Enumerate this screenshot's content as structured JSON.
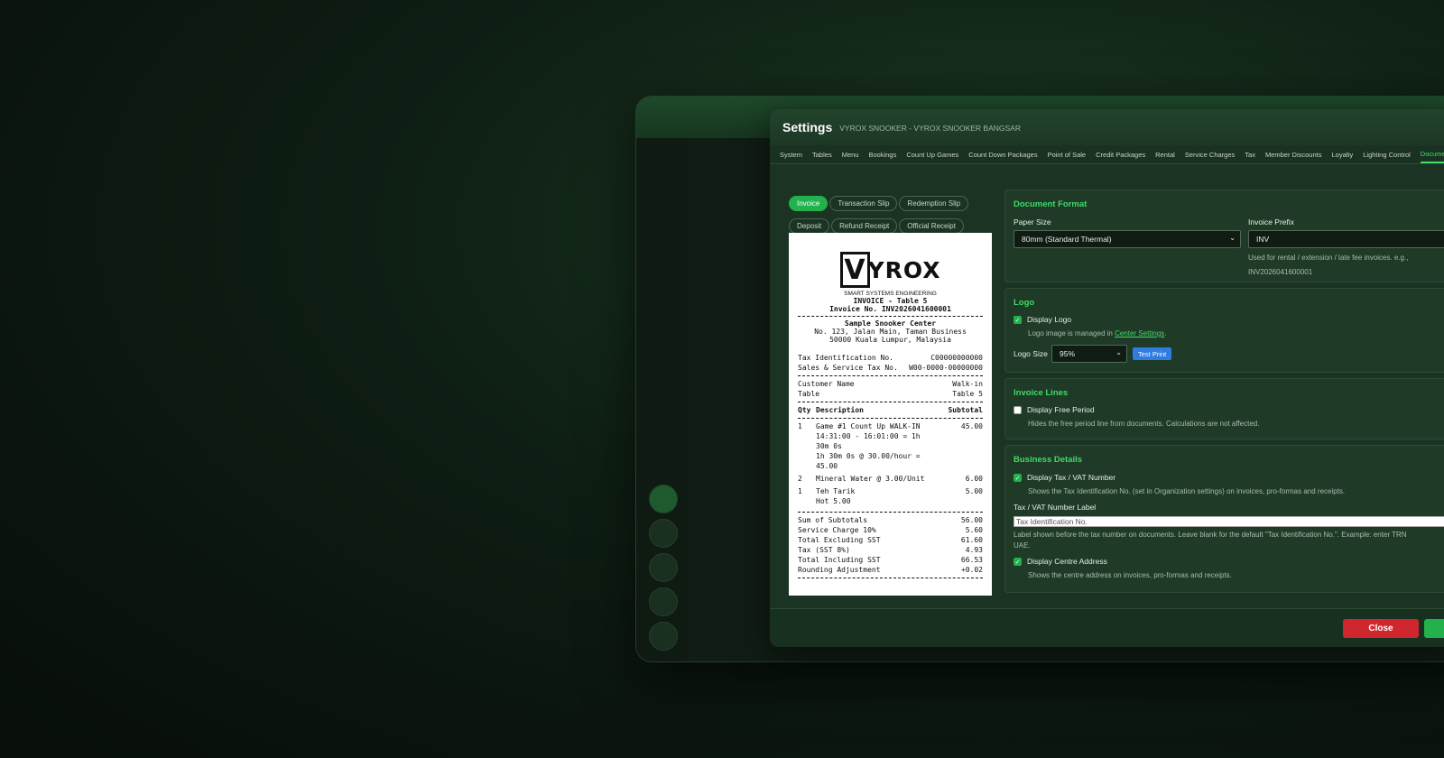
{
  "modal": {
    "title": "Settings",
    "subtitle": "VYROX SNOOKER - VYROX SNOOKER BANGSAR",
    "tabs": [
      "System",
      "Tables",
      "Menu",
      "Bookings",
      "Count Up Games",
      "Count Down Packages",
      "Point of Sale",
      "Credit Packages",
      "Rental",
      "Service Charges",
      "Tax",
      "Member Discounts",
      "Loyalty",
      "Lighting Control",
      "Document"
    ],
    "active_tab": "Document"
  },
  "doc_types": [
    "Invoice",
    "Transaction Slip",
    "Redemption Slip",
    "Deposit",
    "Refund Receipt",
    "Official Receipt"
  ],
  "receipt": {
    "logo_mark": "V",
    "logo_text": "YROX",
    "tagline": "SMART SYSTEMS ENGINEERING",
    "heading": "INVOICE - Table 5",
    "invoice_no": "Invoice No. INV2026041600001",
    "center_name": "Sample Snooker Center",
    "address1": "No. 123, Jalan Main, Taman Business",
    "address2": "50000 Kuala Lumpur, Malaysia",
    "tax_label": "Tax Identification No.",
    "tax_value": "C00000000000",
    "sst_label": "Sales & Service Tax No.",
    "sst_value": "W00-0000-00000000",
    "customer_label": "Customer Name",
    "customer_value": "Walk-in",
    "table_label": "Table",
    "table_value": "Table 5",
    "col_qty": "Qty",
    "col_desc": "Description",
    "col_subtotal": "Subtotal",
    "items": [
      {
        "qty": "1",
        "desc": "Game #1 Count Up WALK-IN",
        "amt": "45.00",
        "lines": [
          "14:31:00 - 16:01:00 = 1h",
          "30m 0s",
          "1h 30m 0s @ 30.00/hour =",
          "45.00"
        ]
      },
      {
        "qty": "2",
        "desc": "Mineral Water @ 3.00/Unit",
        "amt": "6.00",
        "lines": []
      },
      {
        "qty": "1",
        "desc": "Teh Tarik",
        "amt": "5.00",
        "lines": [
          "Hot 5.00"
        ]
      }
    ],
    "totals": [
      {
        "label": "Sum of Subtotals",
        "value": "56.00"
      },
      {
        "label": "Service Charge 10%",
        "value": "5.60"
      },
      {
        "label": "Total Excluding SST",
        "value": "61.60"
      },
      {
        "label": "Tax (SST 8%)",
        "value": "4.93"
      },
      {
        "label": "Total Including SST",
        "value": "66.53"
      },
      {
        "label": "Rounding Adjustment",
        "value": "+0.02"
      }
    ]
  },
  "document_format": {
    "title": "Document Format",
    "paper_size_label": "Paper Size",
    "paper_size_value": "80mm (Standard Thermal)",
    "invoice_prefix_label": "Invoice Prefix",
    "invoice_prefix_value": "INV",
    "prefix_hint_1": "Used for rental / extension / late fee invoices. e.g.,",
    "prefix_hint_2": "INV2026041600001"
  },
  "logo": {
    "title": "Logo",
    "display_logo_label": "Display Logo",
    "display_logo_checked": true,
    "hint_prefix": "Logo image is managed in ",
    "hint_link": "Center Settings",
    "hint_suffix": ".",
    "size_label": "Logo Size",
    "size_value": "95%",
    "test_print": "Test Print"
  },
  "invoice_lines": {
    "title": "Invoice Lines",
    "free_period_label": "Display Free Period",
    "free_period_checked": false,
    "free_period_hint": "Hides the free period line from documents. Calculations are not affected."
  },
  "business_details": {
    "title": "Business Details",
    "tax_label": "Display Tax / VAT Number",
    "tax_checked": true,
    "tax_hint": "Shows the Tax Identification No. (set in Organization settings) on invoices, pro-formas and receipts.",
    "vat_label_title": "Tax / VAT Number Label",
    "vat_placeholder": "Tax Identification No.",
    "vat_hint_1": "Label shown before the tax number on documents. Leave blank for the default \"Tax Identification No.\". Example: enter TRN",
    "vat_hint_2": "UAE.",
    "address_label": "Display Centre Address",
    "address_checked": true,
    "address_hint": "Shows the centre address on invoices, pro-formas and receipts."
  },
  "footer": {
    "close": "Close"
  },
  "rail": [
    "••",
    "•••",
    "••",
    "••",
    "••"
  ]
}
